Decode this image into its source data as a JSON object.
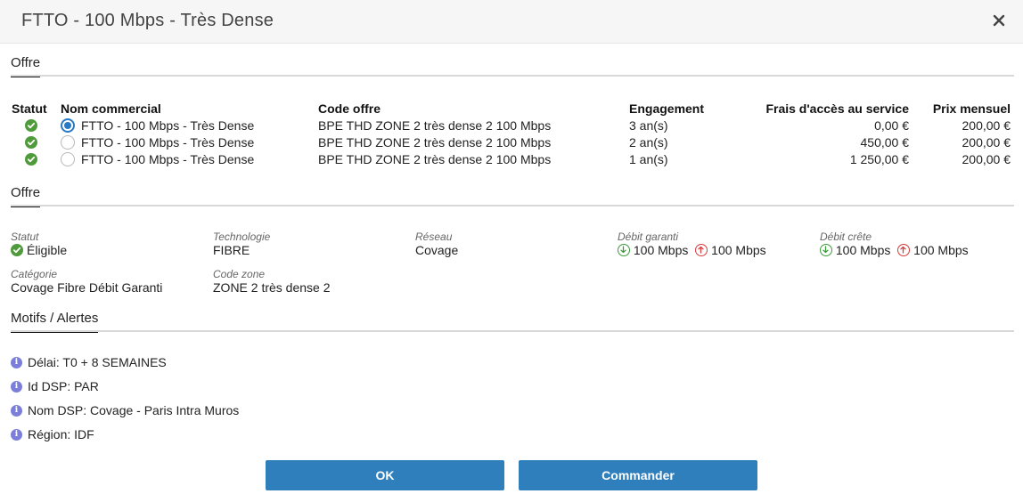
{
  "dialog": {
    "title": "FTTO - 100 Mbps - Très Dense"
  },
  "offer_table": {
    "section_label": "Offre",
    "headers": {
      "statut": "Statut",
      "nom": "Nom commercial",
      "code": "Code offre",
      "engagement": "Engagement",
      "frais": "Frais d'accès au service",
      "prix": "Prix mensuel"
    },
    "rows": [
      {
        "nom": "FTTO - 100 Mbps - Très Dense",
        "code": "BPE THD ZONE 2 très dense 2 100 Mbps",
        "engagement": "3 an(s)",
        "frais": "0,00 €",
        "prix": "200,00 €",
        "selected": true
      },
      {
        "nom": "FTTO - 100 Mbps - Très Dense",
        "code": "BPE THD ZONE 2 très dense 2 100 Mbps",
        "engagement": "2 an(s)",
        "frais": "450,00 €",
        "prix": "200,00 €",
        "selected": false
      },
      {
        "nom": "FTTO - 100 Mbps - Très Dense",
        "code": "BPE THD ZONE 2 très dense 2 100 Mbps",
        "engagement": "1 an(s)",
        "frais": "1 250,00 €",
        "prix": "200,00 €",
        "selected": false
      }
    ]
  },
  "offer_details": {
    "section_label": "Offre",
    "statut": {
      "label": "Statut",
      "value": "Éligible"
    },
    "technologie": {
      "label": "Technologie",
      "value": "FIBRE"
    },
    "reseau": {
      "label": "Réseau",
      "value": "Covage"
    },
    "debit_garanti": {
      "label": "Débit garanti",
      "down": "100 Mbps",
      "up": "100 Mbps"
    },
    "debit_crete": {
      "label": "Débit crête",
      "down": "100 Mbps",
      "up": "100 Mbps"
    },
    "categorie": {
      "label": "Catégorie",
      "value": "Covage Fibre Débit Garanti"
    },
    "code_zone": {
      "label": "Code zone",
      "value": "ZONE 2 très dense 2"
    }
  },
  "alerts": {
    "section_label": "Motifs / Alertes",
    "items": [
      "Délai: T0 + 8 SEMAINES",
      "Id DSP: PAR",
      "Nom DSP: Covage - Paris Intra Muros",
      "Région: IDF"
    ]
  },
  "buttons": {
    "ok": "OK",
    "commander": "Commander"
  },
  "colors": {
    "primary": "#2f7fbd",
    "success": "#4f9a3b",
    "info": "#7b7fd9",
    "up_arrow": "#d63b3b",
    "down_arrow": "#3c9a3c"
  }
}
